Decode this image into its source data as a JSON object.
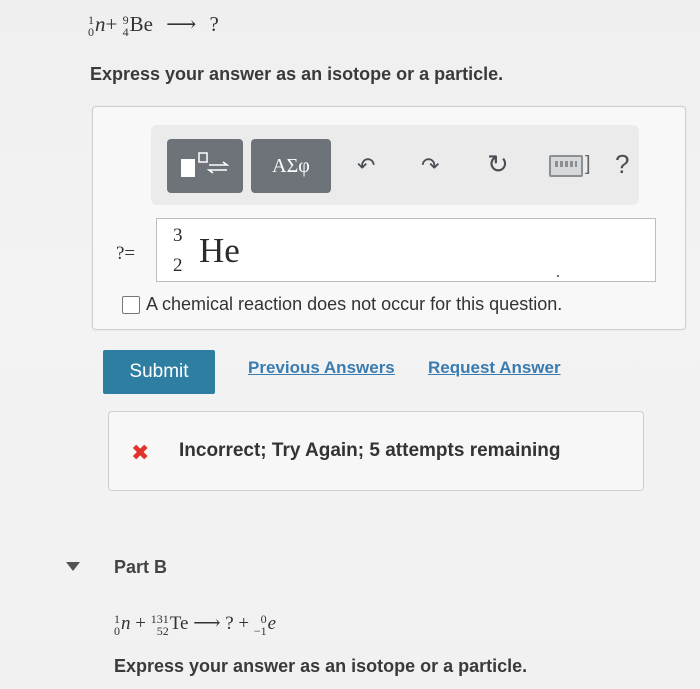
{
  "part_a": {
    "equation": {
      "n_mass": "1",
      "n_atomic": "0",
      "n_symbol": "n",
      "plus": "+",
      "be_mass": "9",
      "be_atomic": "4",
      "be_symbol": "Be",
      "arrow": "⟶",
      "result": "?"
    },
    "instruction": "Express your answer as an isotope or a particle.",
    "toolbar": {
      "template_label": "■⁼⇌",
      "greek_label": "ΑΣφ",
      "undo_icon": "↶",
      "redo_icon": "↷",
      "reset_icon": "↻",
      "keyboard_bracket": "]",
      "help_label": "?"
    },
    "answer_prefix": "?=",
    "answer": {
      "mass": "3",
      "atomic": "2",
      "symbol": "He"
    },
    "no_reaction_label": "A chemical reaction does not occur for this question.",
    "submit_label": "Submit",
    "previous_answers_label": "Previous Answers",
    "request_answer_label": "Request Answer",
    "feedback": {
      "icon": "✖",
      "message": "Incorrect; Try Again; 5 attempts remaining",
      "color": "#e2322b"
    }
  },
  "part_b": {
    "title": "Part B",
    "equation": {
      "n_mass": "1",
      "n_atomic": "0",
      "n_symbol": "n",
      "plus": "+",
      "te_mass": "131",
      "te_atomic": "52",
      "te_symbol": "Te",
      "arrow": "⟶",
      "unknown": "?",
      "plus2": "+",
      "e_mass": "0",
      "e_atomic": "−1",
      "e_symbol": "e"
    },
    "instruction": "Express your answer as an isotope or a particle."
  },
  "colors": {
    "submit_bg": "#2e7ea1",
    "link": "#3a7bb0",
    "toolbar_button": "#6d7378"
  }
}
